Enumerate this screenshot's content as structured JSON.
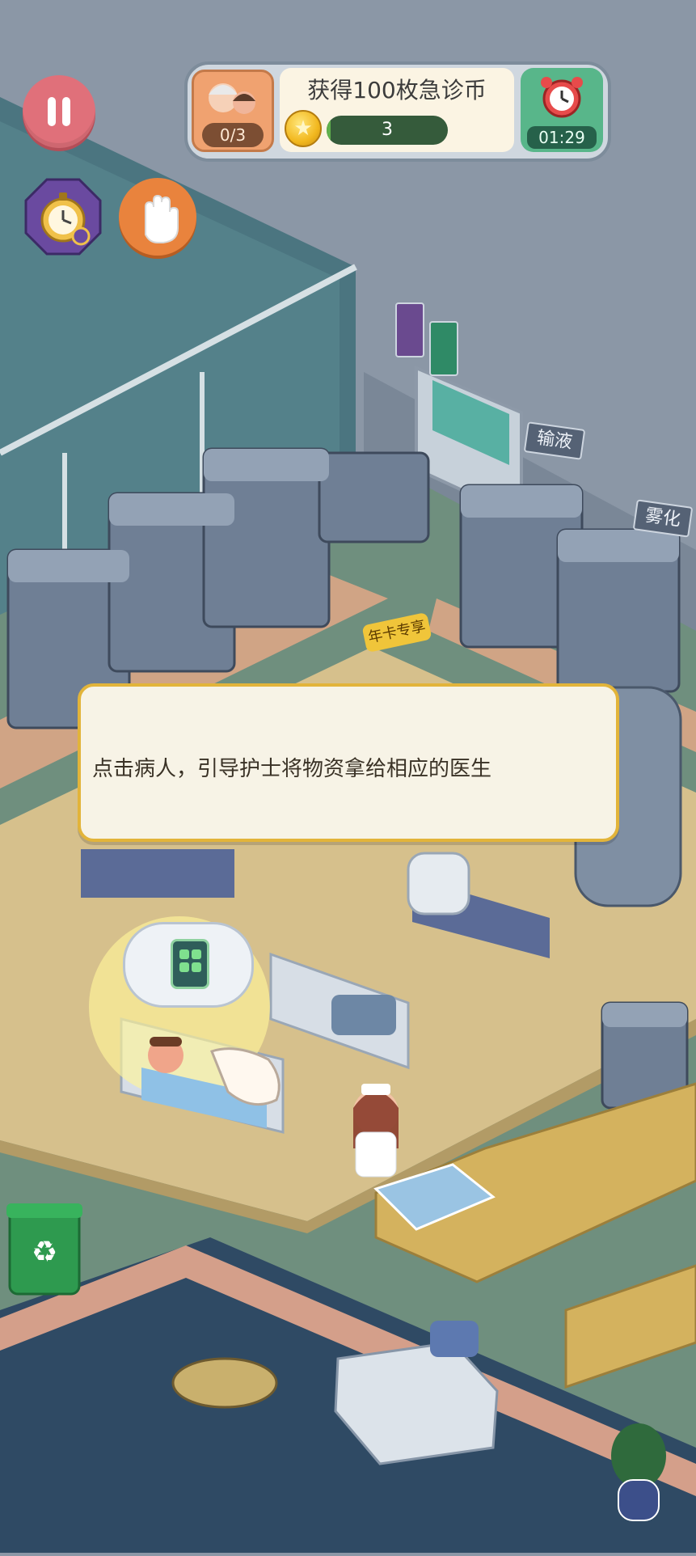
{
  "hud": {
    "patients_progress": "0/3",
    "task_title": "获得100枚急诊币",
    "coin_count": "3",
    "coin_progress": 0.03,
    "timer": "01:29"
  },
  "tutorial": {
    "instruction": "点击病人，引导护士将物资拿给相应的医生"
  },
  "signs": {
    "infusion": "输液",
    "nebulize": "雾化",
    "annual_card": "年卡专享"
  },
  "colors": {
    "floor_dark": "#6f8f7e",
    "floor_tan": "#d6c08c",
    "wall": "#8b97a6",
    "accent_border": "#e2b43a",
    "coin_bar": "#5fb04d"
  },
  "icons": {
    "pause": "pause-icon",
    "stopwatch": "stopwatch-icon",
    "hand": "hand-icon",
    "alarm": "alarm-clock-icon",
    "coin": "star-coin-icon",
    "recycle": "recycle-bin-icon",
    "supply": "medical-supply-icon"
  }
}
